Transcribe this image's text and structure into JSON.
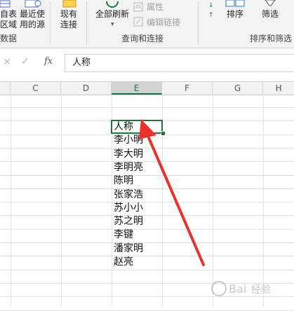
{
  "ribbon": {
    "get_data": {
      "line1": "自表",
      "line2": "区域"
    },
    "recent_sources": {
      "line1": "最近使",
      "line2": "用的源"
    },
    "existing_connections": {
      "line1": "现有",
      "line2": "连接"
    },
    "refresh_all": "全部刷新",
    "properties": "属性",
    "edit_links": "编辑链接",
    "sort": "排序",
    "filter": "筛选",
    "groups": {
      "get_transform": "数据",
      "queries_connections": "查询和连接",
      "sort_filter": "排序和筛选"
    }
  },
  "formula_bar": {
    "fx_symbol": "fx",
    "value": "人称"
  },
  "columns": [
    "C",
    "D",
    "E",
    "F",
    "G",
    "H"
  ],
  "selected_column": "E",
  "cells": [
    "人称",
    "李小明",
    "李大明",
    "李明亮",
    "陈明",
    "张家浩",
    "苏小小",
    "苏之明",
    "李键",
    "潘家明",
    "赵亮"
  ],
  "colors": {
    "accent": "#217346",
    "arrow": "#e8332d"
  }
}
